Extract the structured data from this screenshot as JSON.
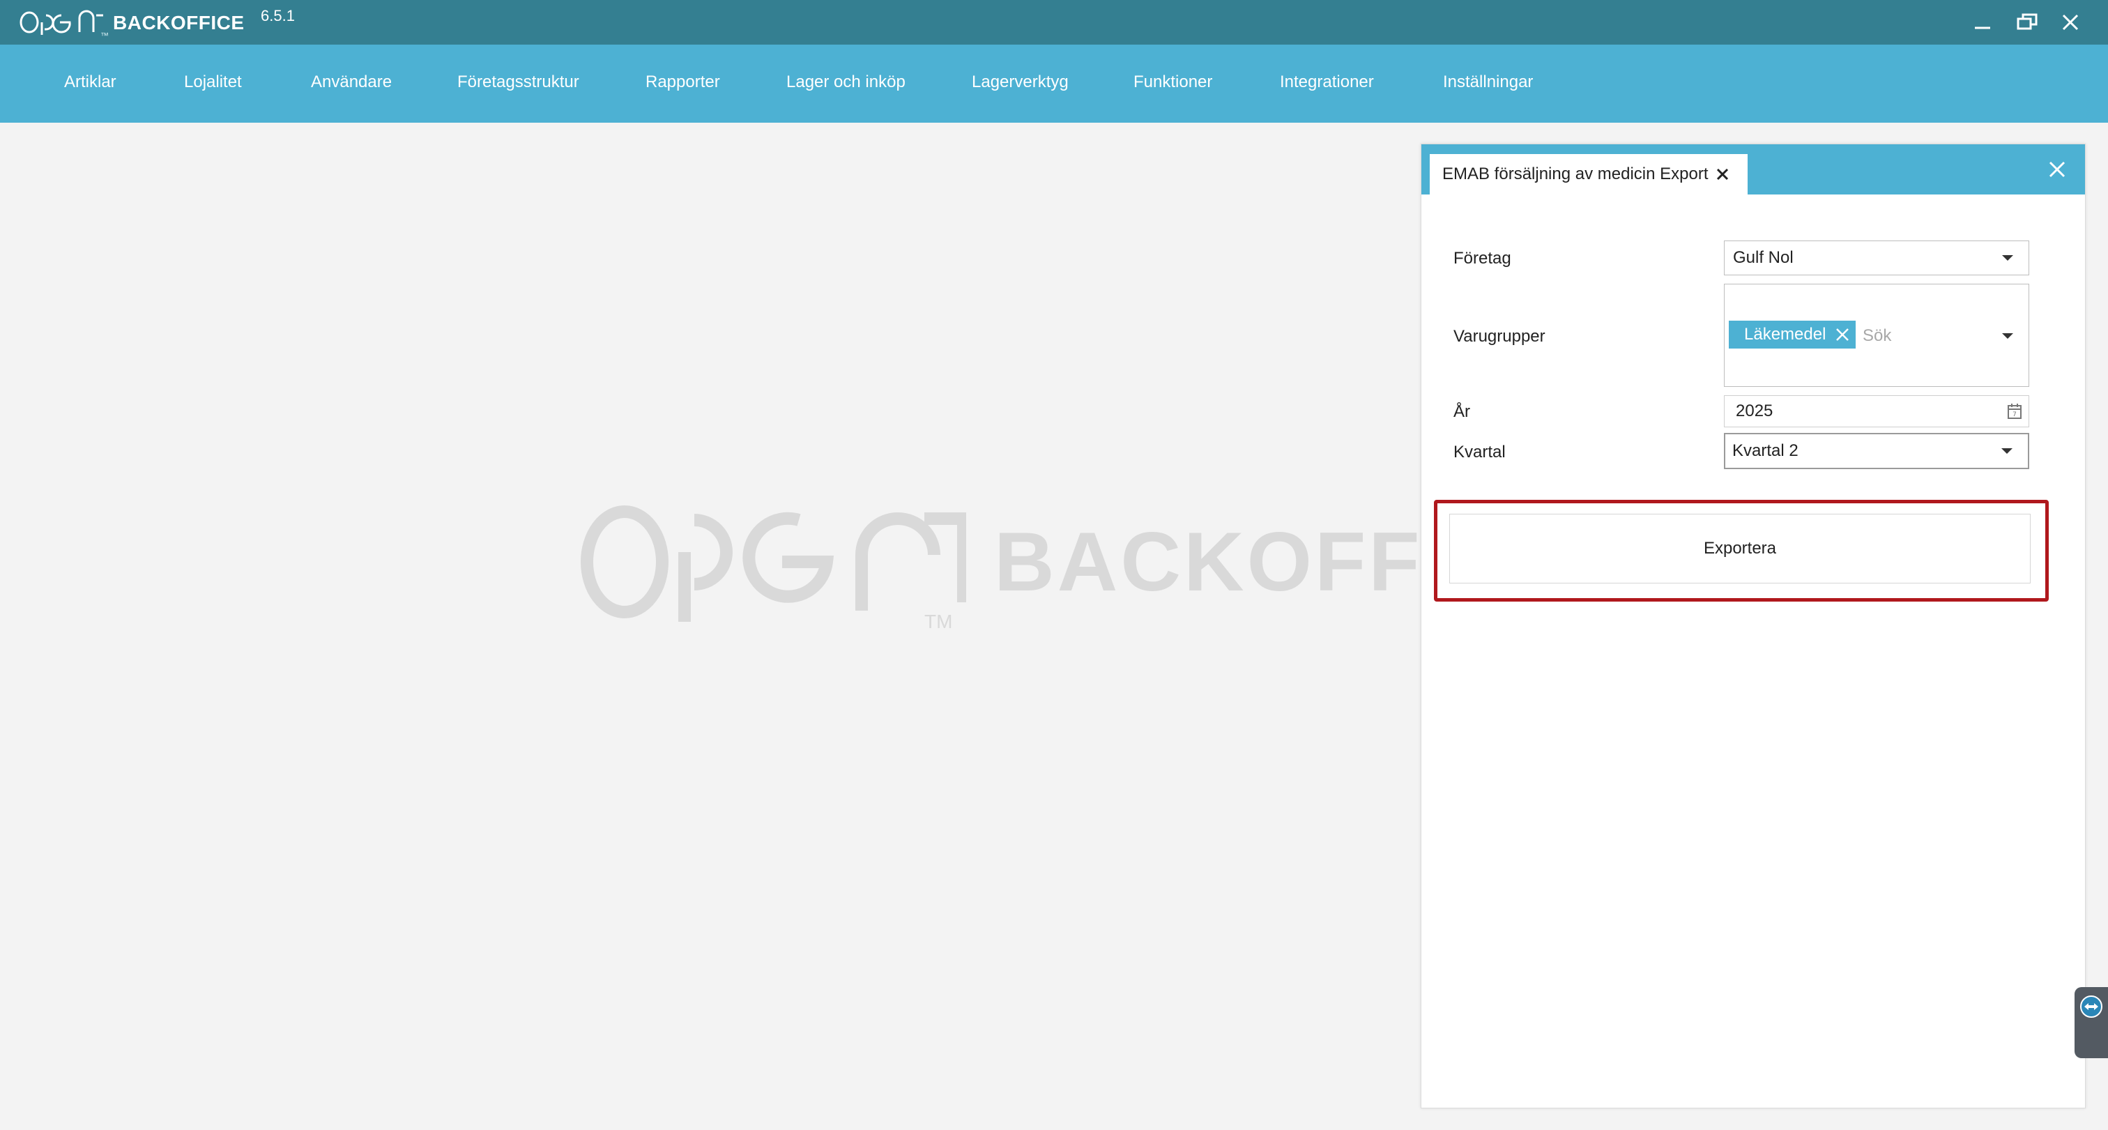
{
  "titlebar": {
    "logo_mark": "Ope∦",
    "logo_tm": "™",
    "brand": "BACKOFFICE",
    "version": "6.5.1",
    "bg_color": "#347f91"
  },
  "nav": {
    "bg_color": "#4db1d3",
    "items": [
      {
        "label": "Artiklar"
      },
      {
        "label": "Lojalitet"
      },
      {
        "label": "Användare"
      },
      {
        "label": "Företagsstruktur"
      },
      {
        "label": "Rapporter"
      },
      {
        "label": "Lager och inköp"
      },
      {
        "label": "Lagerverktyg"
      },
      {
        "label": "Funktioner"
      },
      {
        "label": "Integrationer"
      },
      {
        "label": "Inställningar"
      }
    ]
  },
  "watermark": {
    "logo_mark": "Ope∦",
    "text": "BACKOFFIC",
    "tm": "TM"
  },
  "panel": {
    "tab_title": "EMAB försäljning av medicin Export",
    "fields": {
      "company_label": "Företag",
      "company_value": "Gulf Nol",
      "groups_label": "Varugrupper",
      "groups_tag": "Läkemedel",
      "groups_search_placeholder": "Sök",
      "year_label": "År",
      "year_value": "2025",
      "quarter_label": "Kvartal",
      "quarter_value": "Kvartal 2"
    },
    "export_label": "Exportera",
    "highlight_color": "#b0181d"
  }
}
